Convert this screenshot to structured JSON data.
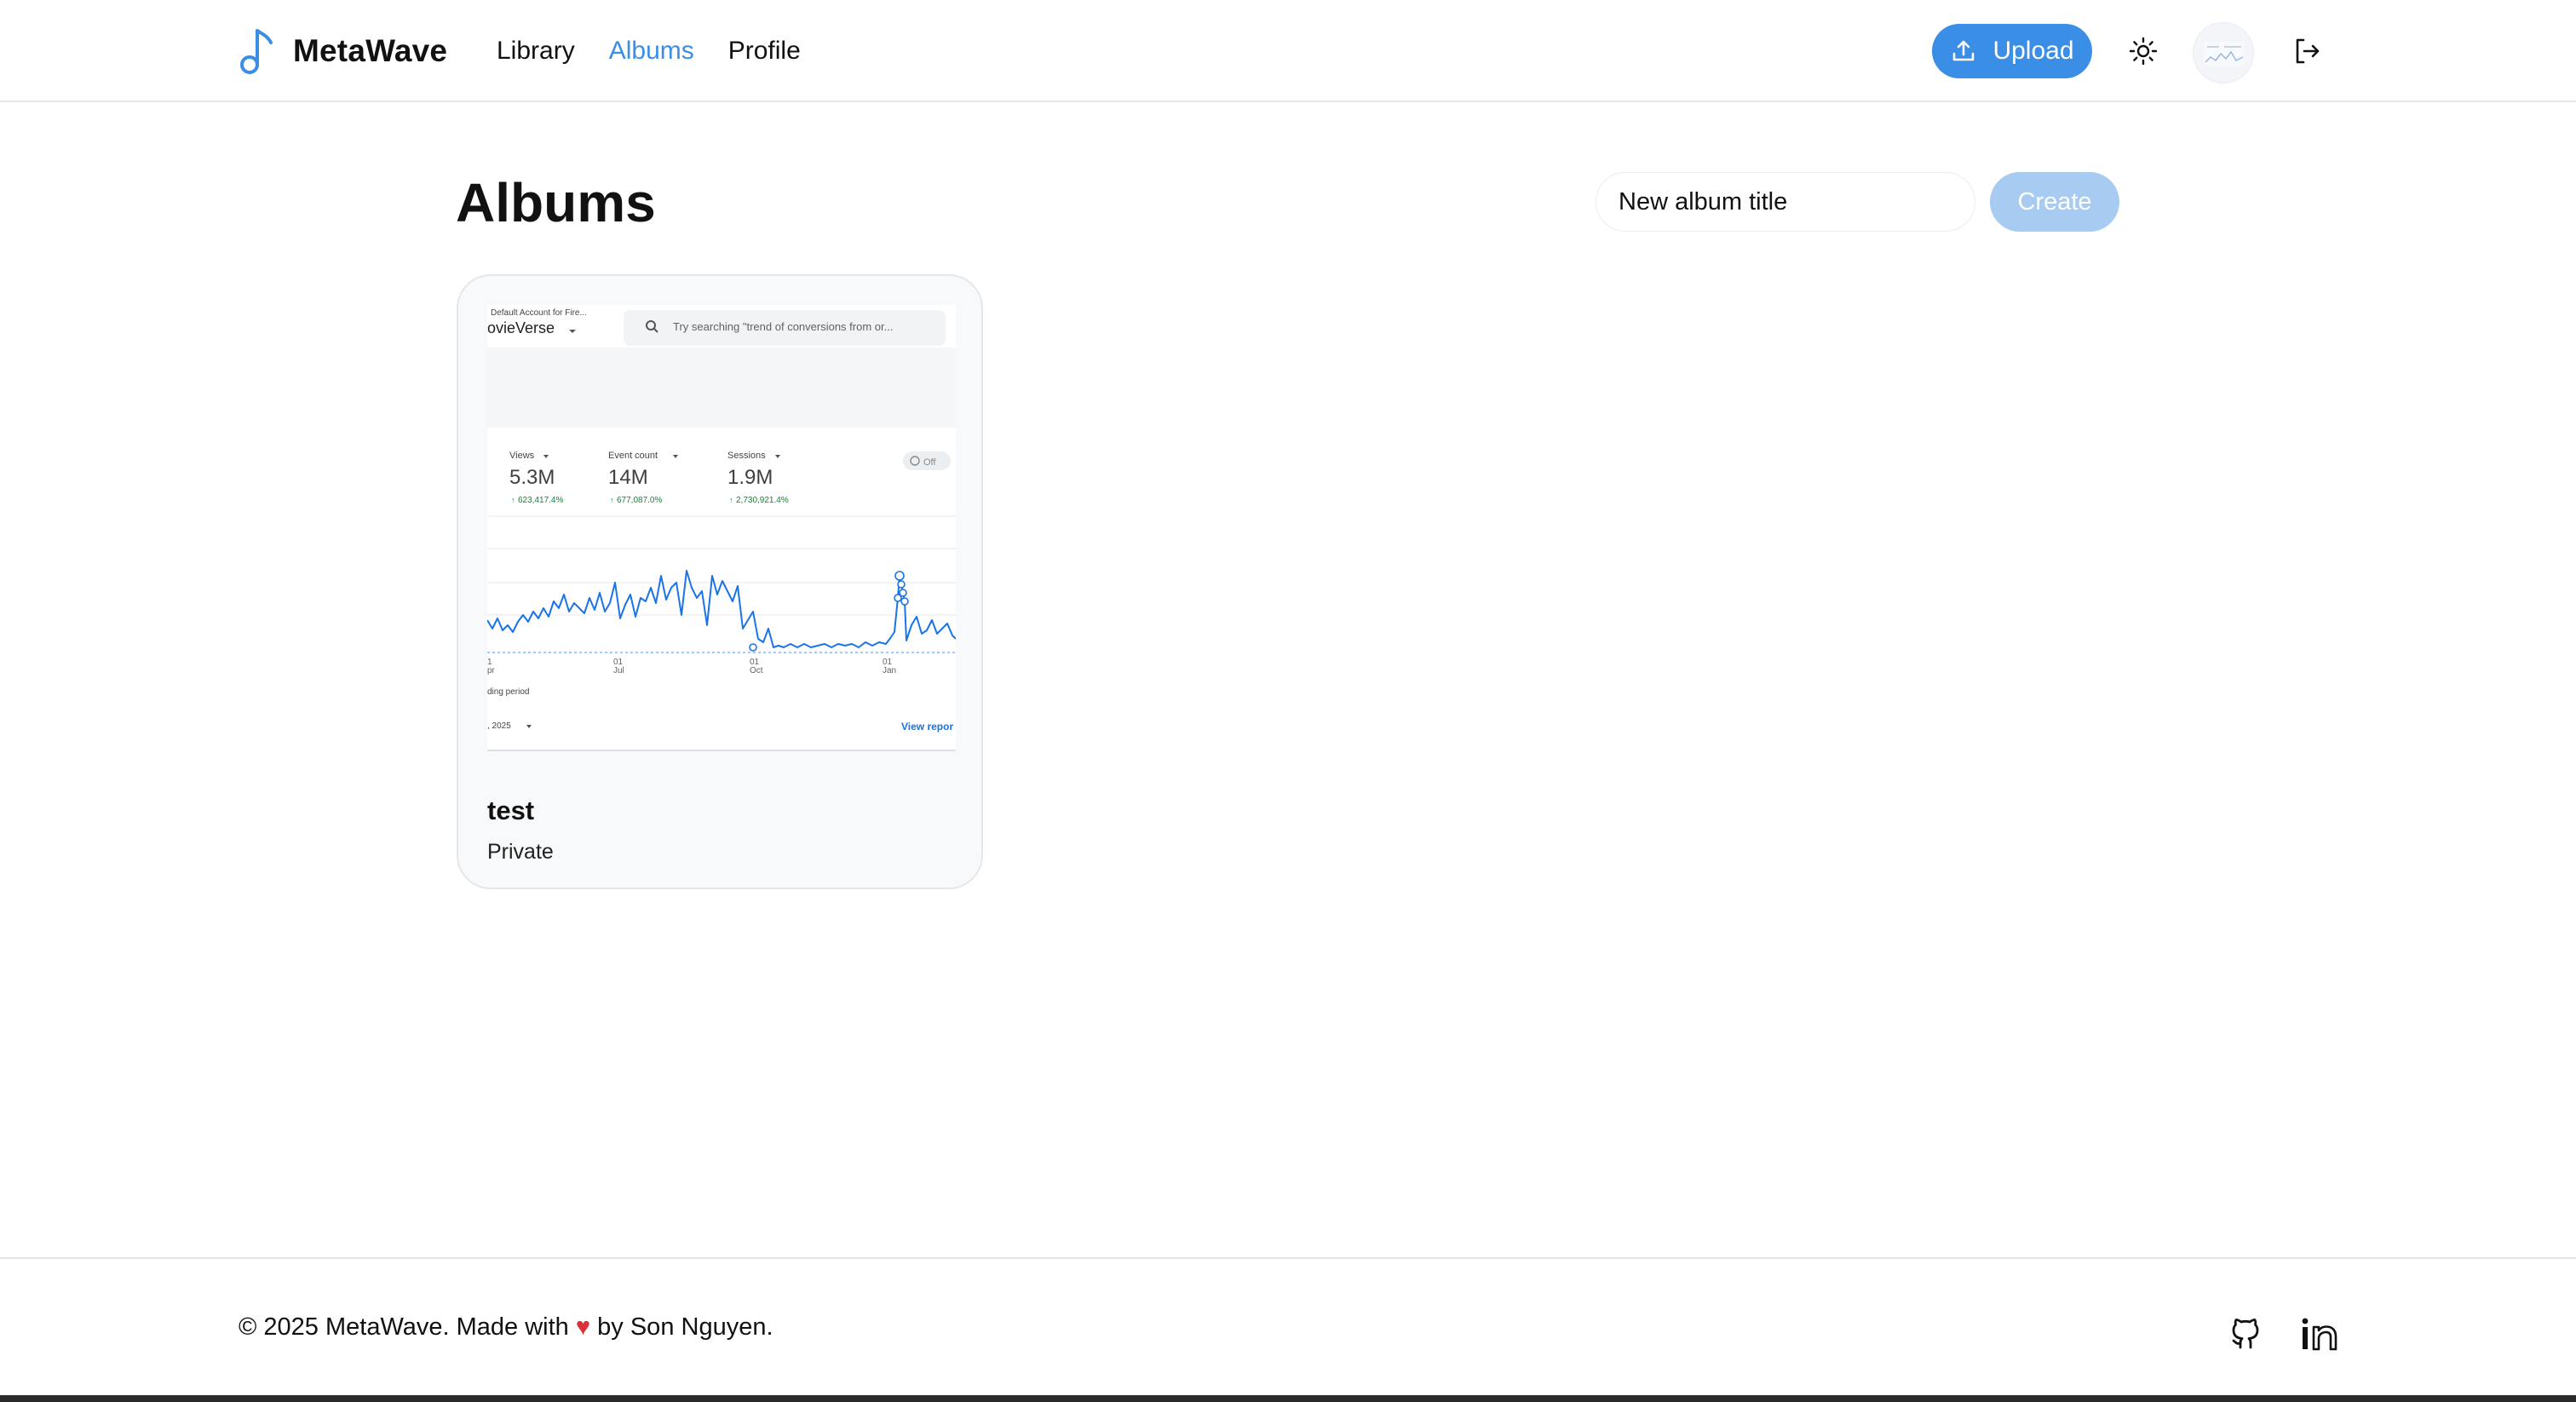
{
  "brand": {
    "name": "MetaWave",
    "icon": "music-note-icon",
    "accent": "#3b8ee6"
  },
  "nav": {
    "items": [
      {
        "label": "Library",
        "active": false
      },
      {
        "label": "Albums",
        "active": true
      },
      {
        "label": "Profile",
        "active": false
      }
    ]
  },
  "header": {
    "upload_label": "Upload",
    "upload_icon": "upload-icon",
    "theme_icon": "sun-icon",
    "logout_icon": "logout-icon"
  },
  "main": {
    "title": "Albums",
    "new_album": {
      "placeholder": "New album title",
      "value": ""
    },
    "create_label": "Create",
    "albums": [
      {
        "title": "test",
        "visibility": "Private",
        "thumbnail": {
          "account": "Default Account for Fire...",
          "property": "ovieVerse",
          "search_placeholder": "Try searching \"trend of conversions from or...",
          "metrics": [
            {
              "label": "Views",
              "value": "5.3M",
              "change": "623,417.4%"
            },
            {
              "label": "Event count",
              "value": "14M",
              "change": "677,087.0%"
            },
            {
              "label": "Sessions",
              "value": "1.9M",
              "change": "2,730,921.4%"
            }
          ],
          "toggle_label": "Off",
          "x_ticks": [
            {
              "day": "1",
              "month": "pr"
            },
            {
              "day": "01",
              "month": "Jul"
            },
            {
              "day": "01",
              "month": "Oct"
            },
            {
              "day": "01",
              "month": "Jan"
            }
          ],
          "legend_text": "ding period",
          "date_range": ", 2025",
          "view_report": "View repor"
        }
      }
    ]
  },
  "footer": {
    "copyright": "© 2025 MetaWave. Made with",
    "heart": "♥",
    "author": "by Son Nguyen.",
    "github_icon": "github-icon",
    "linkedin_icon": "linkedin-icon"
  }
}
